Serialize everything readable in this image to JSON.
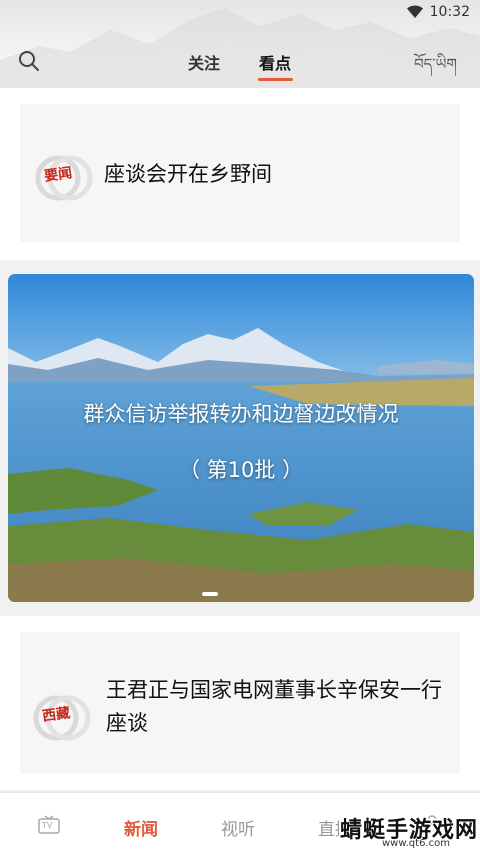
{
  "status_bar": {
    "time": "10:32",
    "wifi_icon": "wifi-icon"
  },
  "header": {
    "search_icon": "search-icon",
    "tabs": [
      {
        "label": "关注",
        "active": false
      },
      {
        "label": "看点",
        "active": true
      }
    ],
    "language_toggle": "བོད་ཡིག"
  },
  "feed": {
    "card1": {
      "source_logo": "要闻",
      "title": "座谈会开在乡野间"
    },
    "banner": {
      "line1": "群众信访举报转办和边督边改情况",
      "line2": "（ 第10批 ）",
      "page_indicator": "1"
    },
    "card3": {
      "source_logo": "西藏",
      "title": "王君正与国家电网董事长辛保安一行座谈"
    }
  },
  "bottom_nav": {
    "items": [
      {
        "label": "TV",
        "icon": "tv-icon"
      },
      {
        "label": "新闻",
        "active": true
      },
      {
        "label": "视听"
      },
      {
        "label": "直播"
      },
      {
        "label": "我",
        "icon": "user-icon"
      }
    ]
  },
  "watermark": {
    "text": "蜻蜓手游戏网",
    "url": "www.qt6.com"
  },
  "colors": {
    "accent": "#e45a3c",
    "logo_red": "#c8251d"
  }
}
